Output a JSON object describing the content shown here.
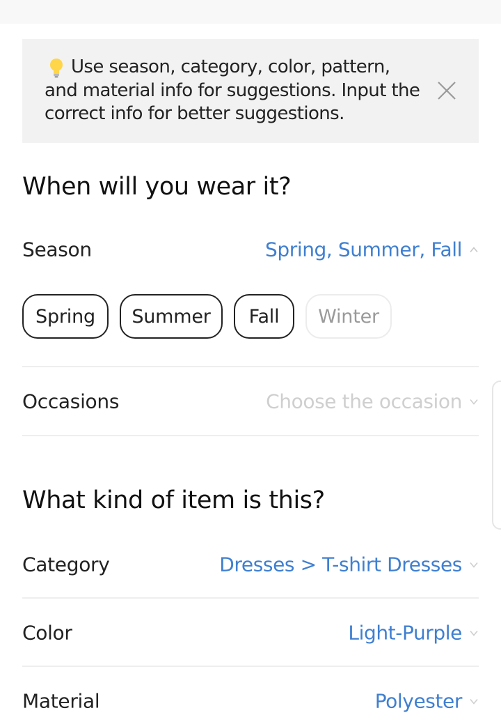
{
  "tip": {
    "text": "Use season, category, color, pattern, and material info for suggestions. Input the correct info for better suggestions."
  },
  "sections": {
    "when_title": "When will you wear it?",
    "kind_title": "What kind of item is this?"
  },
  "season": {
    "label": "Season",
    "value": "Spring, Summer, Fall",
    "chips": [
      {
        "label": "Spring",
        "selected": true
      },
      {
        "label": "Summer",
        "selected": true
      },
      {
        "label": "Fall",
        "selected": true
      },
      {
        "label": "Winter",
        "selected": false
      }
    ]
  },
  "occasions": {
    "label": "Occasions",
    "placeholder": "Choose the occasion"
  },
  "category": {
    "label": "Category",
    "value": "Dresses > T-shirt Dresses"
  },
  "color": {
    "label": "Color",
    "value": "Light-Purple"
  },
  "material": {
    "label": "Material",
    "value": "Polyester"
  },
  "colors": {
    "accent": "#3f7fd0",
    "placeholder": "#cfcfcf",
    "tip_bg": "#f2f2f2"
  },
  "icons": {
    "tip": "lightbulb-icon",
    "close": "close-icon",
    "expand": "chevron-down-icon",
    "collapse": "chevron-up-icon"
  }
}
